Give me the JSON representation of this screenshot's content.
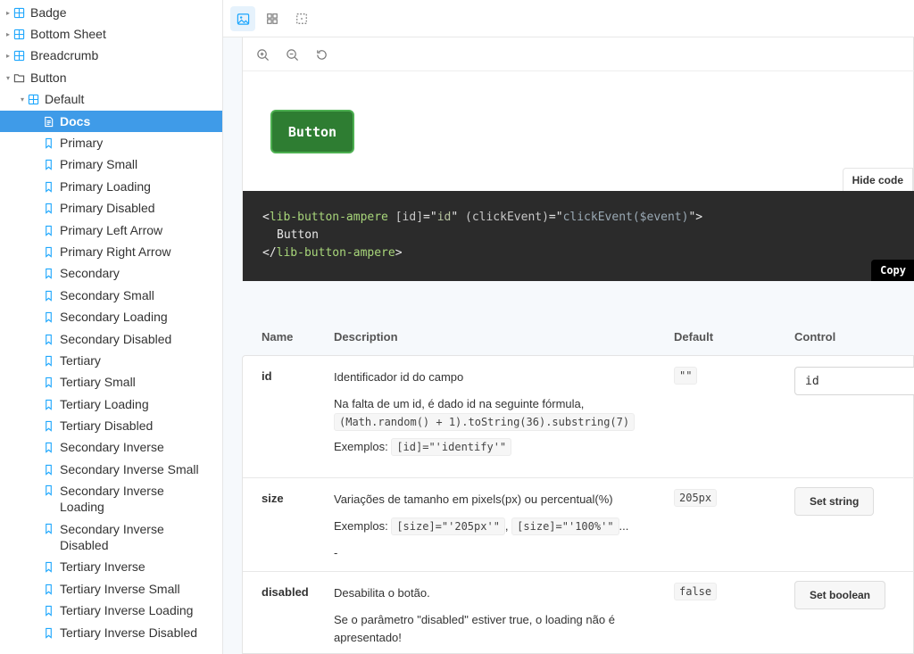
{
  "sidebar": {
    "items": [
      {
        "label": "Badge"
      },
      {
        "label": "Bottom Sheet"
      },
      {
        "label": "Breadcrumb"
      },
      {
        "label": "Button"
      },
      {
        "label": "Default"
      },
      {
        "label": "Docs"
      },
      {
        "label": "Primary"
      },
      {
        "label": "Primary Small"
      },
      {
        "label": "Primary Loading"
      },
      {
        "label": "Primary Disabled"
      },
      {
        "label": "Primary Left Arrow"
      },
      {
        "label": "Primary Right Arrow"
      },
      {
        "label": "Secondary"
      },
      {
        "label": "Secondary Small"
      },
      {
        "label": "Secondary Loading"
      },
      {
        "label": "Secondary Disabled"
      },
      {
        "label": "Tertiary"
      },
      {
        "label": "Tertiary Small"
      },
      {
        "label": "Tertiary Loading"
      },
      {
        "label": "Tertiary Disabled"
      },
      {
        "label": "Secondary Inverse"
      },
      {
        "label": "Secondary Inverse Small"
      },
      {
        "label": "Secondary Inverse Loading"
      },
      {
        "label": "Secondary Inverse Disabled"
      },
      {
        "label": "Tertiary Inverse"
      },
      {
        "label": "Tertiary Inverse Small"
      },
      {
        "label": "Tertiary Inverse Loading"
      },
      {
        "label": "Tertiary Inverse Disabled"
      }
    ],
    "selected_index": 5,
    "selected_color": "#3f9be8"
  },
  "preview": {
    "demo_button_label": "Button",
    "demo_button_color": "#2e7d32",
    "hide_code_label": "Hide code",
    "copy_label": "Copy",
    "code": {
      "open_tag": "lib-button-ampere",
      "attr1": "[id]",
      "val1": "id",
      "attr2": "(clickEvent)",
      "val2": "clickEvent($event)",
      "content": "Button",
      "close_tag": "lib-button-ampere"
    }
  },
  "args_table": {
    "headers": {
      "name": "Name",
      "description": "Description",
      "default": "Default",
      "control": "Control"
    },
    "rows": [
      {
        "name": "id",
        "desc1": "Identificador id do campo",
        "desc2": "Na falta de um id, é dado id na seguinte fórmula,",
        "desc2_code": "(Math.random() + 1).toString(36).substring(7)",
        "examples_label": "Exemplos:",
        "example1": "[id]=\"'identify'\"",
        "default": "\"\"",
        "control_value": "id"
      },
      {
        "name": "size",
        "desc1": "Variações de tamanho em pixels(px) ou percentual(%)",
        "examples_label": "Exemplos:",
        "example1": "[size]=\"'205px'\"",
        "example_sep": ",",
        "example2": "[size]=\"'100%'\"",
        "example_more": "...",
        "dash": "-",
        "default": "205px",
        "control_label": "Set string"
      },
      {
        "name": "disabled",
        "desc1": "Desabilita o botão.",
        "desc2": "Se o parâmetro \"disabled\" estiver true, o loading não é apresentado!",
        "default": "false",
        "control_label": "Set boolean"
      }
    ]
  }
}
